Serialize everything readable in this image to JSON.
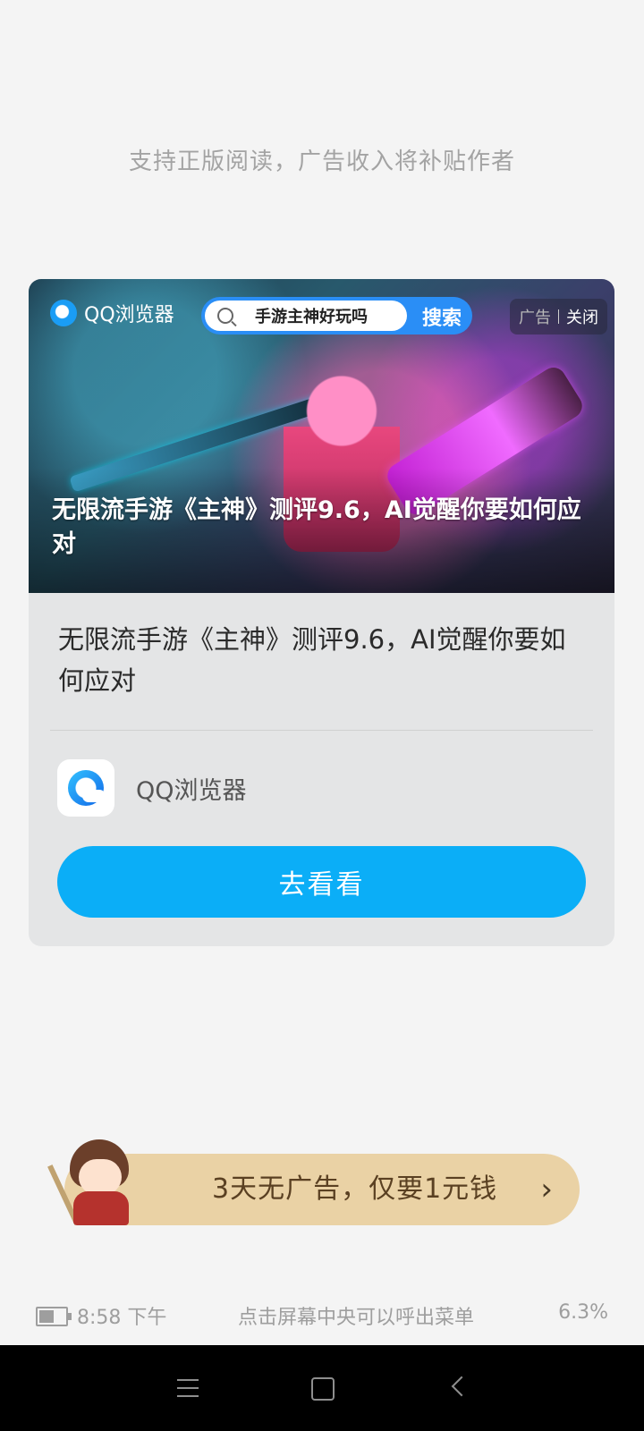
{
  "reader": {
    "support_text": "支持正版阅读，广告收入将补贴作者"
  },
  "ad": {
    "banner": {
      "brand": "QQ浏览器",
      "search_query": "手游主神好玩吗",
      "search_button": "搜索",
      "ad_label": "广告",
      "close_label": "关闭",
      "headline": "无限流手游《主神》测评9.6，AI觉醒你要如何应对"
    },
    "title": "无限流手游《主神》测评9.6，AI觉醒你要如何应对",
    "app_name": "QQ浏览器",
    "app_icon": "qq-browser-icon",
    "cta_label": "去看看",
    "cta_color": "#0baef7"
  },
  "promo": {
    "text": "3天无广告，仅要1元钱",
    "chevron": "›",
    "background_color": "#ead2a5"
  },
  "status_bar": {
    "battery_icon": "battery-icon",
    "time": "8:58 下午",
    "hint": "点击屏幕中央可以呼出菜单",
    "progress": "6.3%"
  },
  "nav_bar": {
    "menu_icon": "menu-icon",
    "home_icon": "home-icon",
    "back_icon": "back-icon"
  }
}
